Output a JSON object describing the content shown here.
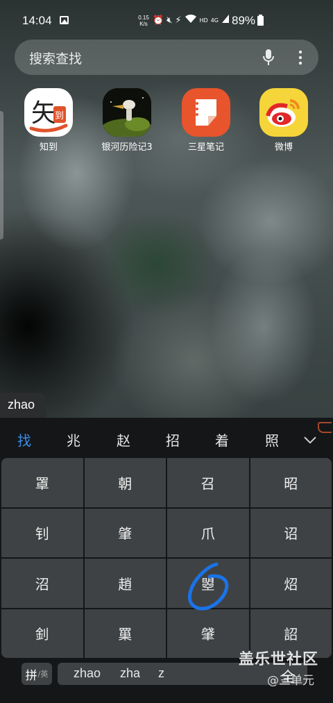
{
  "status_bar": {
    "time": "14:04",
    "net_speed_value": "0.15",
    "net_speed_unit": "K/s",
    "network_label": "HD",
    "network_type": "4G",
    "battery": "89%"
  },
  "search": {
    "placeholder": "搜索查找"
  },
  "apps": [
    {
      "label": "知到"
    },
    {
      "label": "银河历险记3"
    },
    {
      "label": "三星笔记"
    },
    {
      "label": "微博"
    }
  ],
  "app_icon_text": {
    "zhidao_glyph": "矢",
    "zhidao_badge": "到"
  },
  "keyboard": {
    "composing_text": "zhao",
    "candidates": [
      "找",
      "兆",
      "赵",
      "招",
      "着",
      "照"
    ],
    "keys": [
      "罩",
      "朝",
      "召",
      "昭",
      "钊",
      "肇",
      "爪",
      "诏",
      "沼",
      "趙",
      "曌",
      "炤",
      "釗",
      "罺",
      "肈",
      "詔"
    ],
    "lang_main": "拼",
    "lang_sub": "/英",
    "pinyin_options": [
      "zhao",
      "zha",
      "z"
    ],
    "right_key": "全"
  },
  "watermark": {
    "main": "盖乐世社区",
    "sub": "@三单元"
  },
  "colors": {
    "accent": "#3d8ee8",
    "key_bg": "#3f4244",
    "keyboard_bg": "#141618",
    "annotation": "#1a73e8"
  }
}
